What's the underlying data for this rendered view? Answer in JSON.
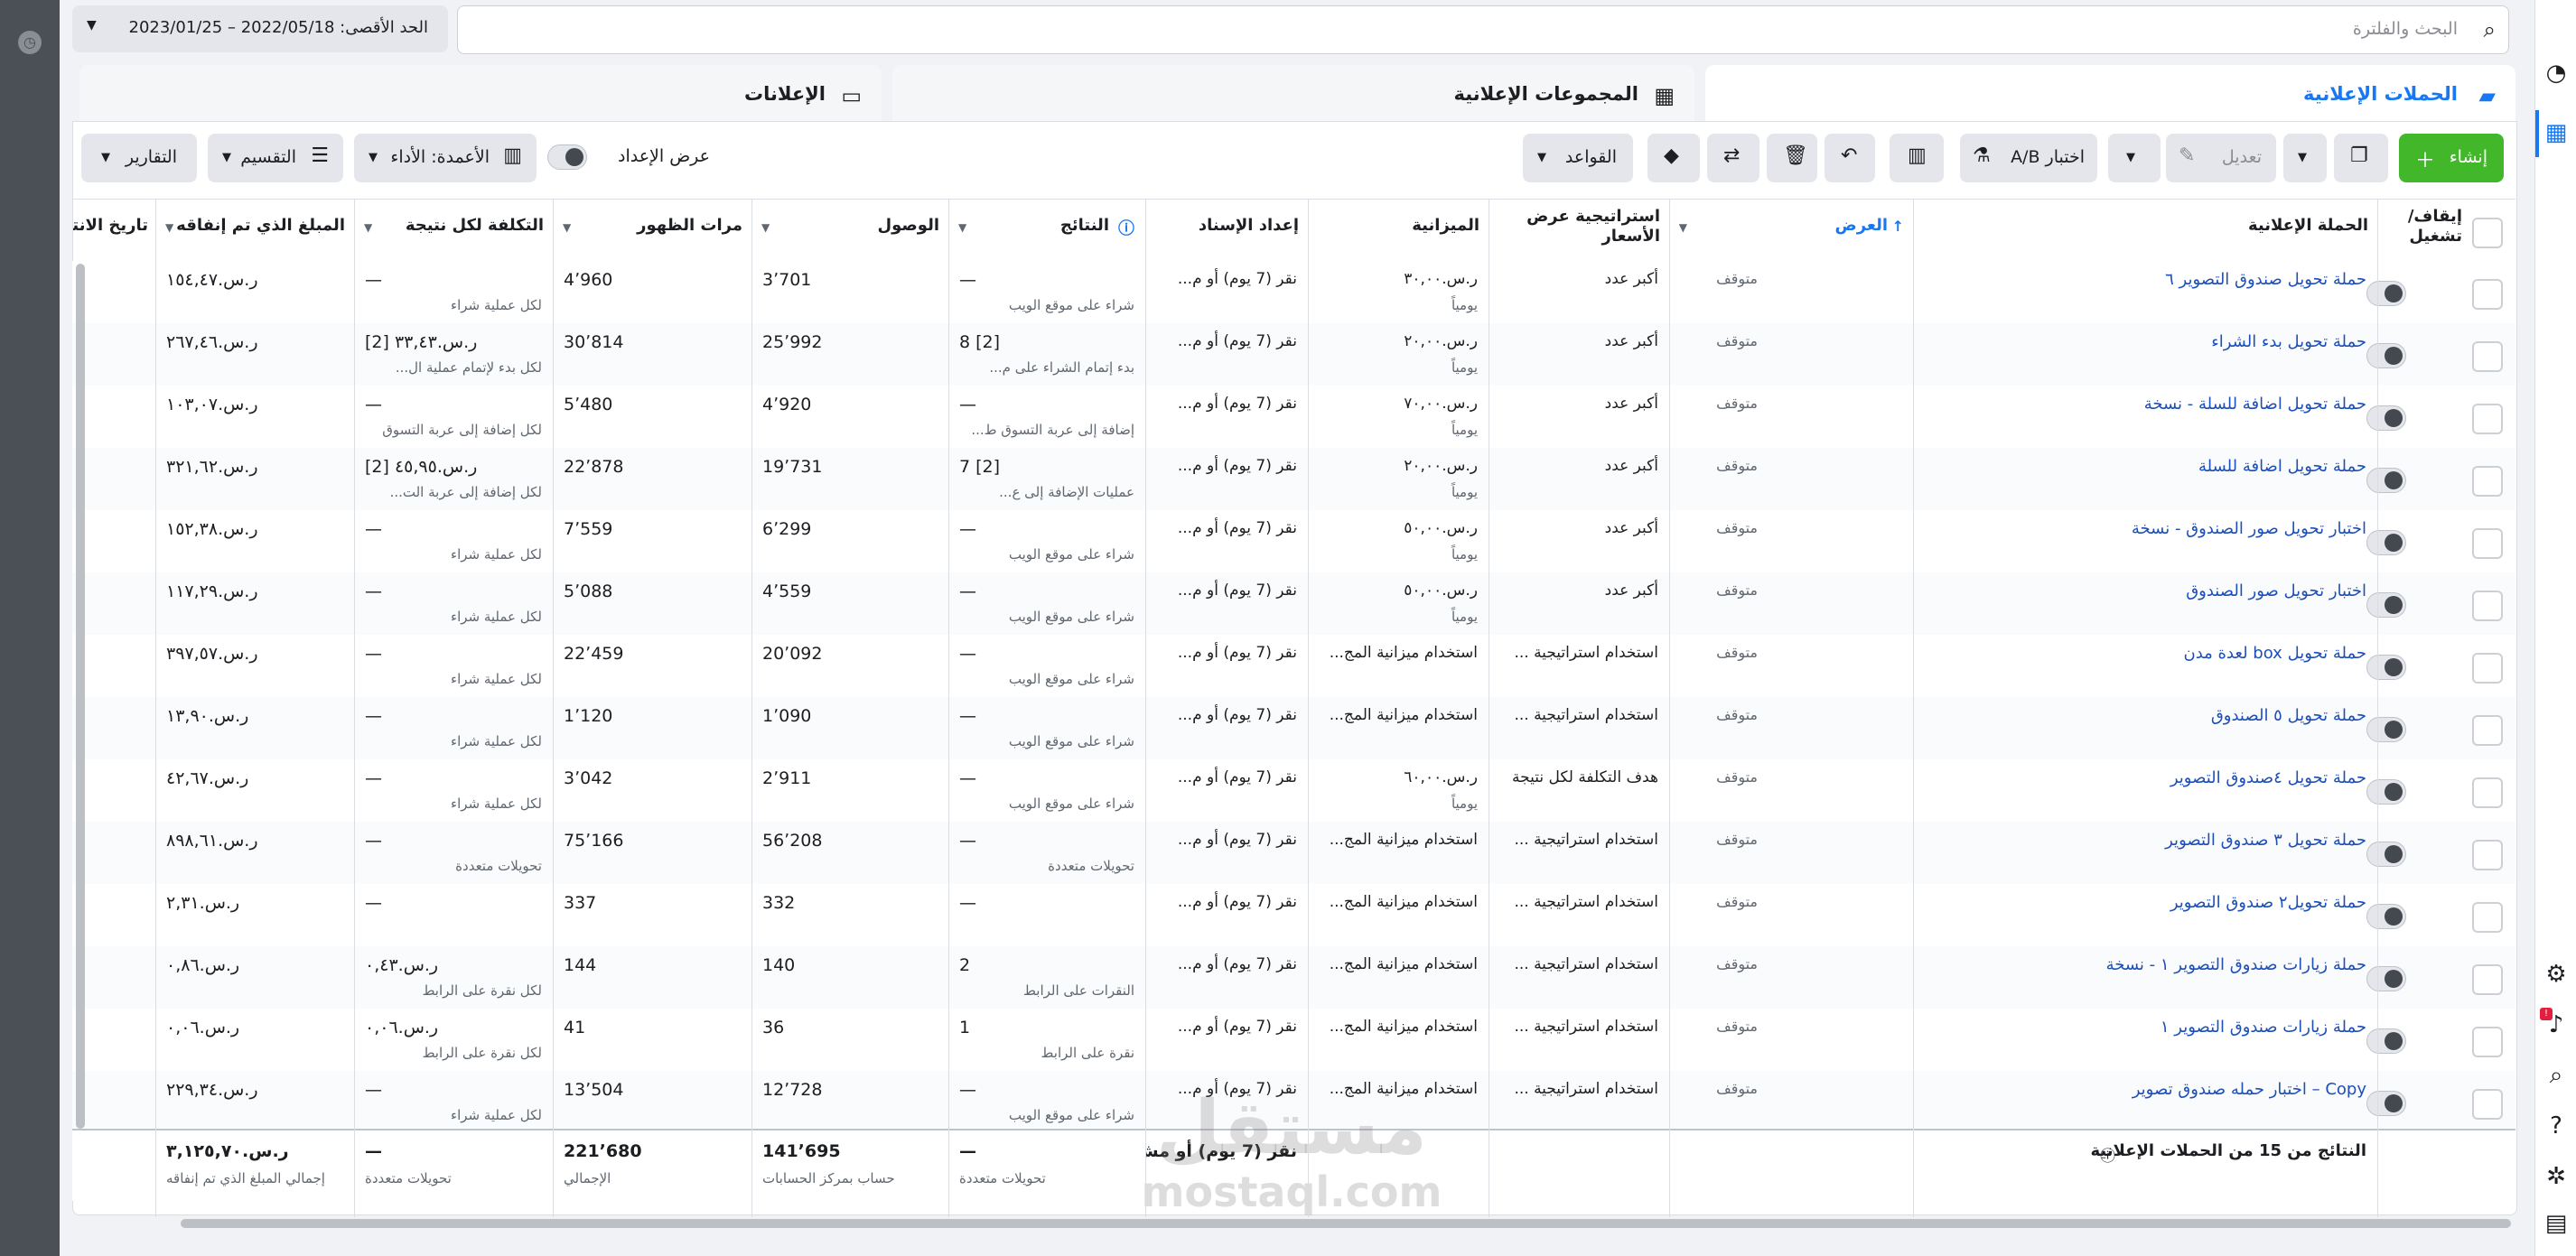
{
  "search": {
    "placeholder": "البحث والفلترة"
  },
  "date_range": {
    "label": "الحد الأقصى: 2022/05/18 – 2023/01/25"
  },
  "tabs": [
    {
      "label": "الحملات الإعلانية",
      "icon": "folder-icon"
    },
    {
      "label": "المجموعات الإعلانية",
      "icon": "grid-icon"
    },
    {
      "label": "الإعلانات",
      "icon": "ad-icon"
    }
  ],
  "toolbar": {
    "create": "إنشاء",
    "edit": "تعديل",
    "ab_test": "اختبار A/B",
    "rules": "القواعد",
    "setup_toggle": "عرض الإعداد",
    "columns": "الأعمدة: الأداء",
    "breakdown": "التقسيم",
    "reports": "التقارير"
  },
  "headers": {
    "toggle": "إيقاف/ تشغيل",
    "campaign": "الحملة الإعلانية",
    "delivery": "العرض",
    "bid_strategy": "استراتيجية عرض الأسعار",
    "budget": "الميزانية",
    "attribution": "إعداد الإسناد",
    "results": "النتائج",
    "reach": "الوصول",
    "impressions": "مرات الظهور",
    "cost_per_result": "التكلفة لكل نتيجة",
    "amount_spent": "المبلغ الذي تم إنفاقه",
    "end": "تاريخ الانته"
  },
  "rows": [
    {
      "name": "حملة تحويل صندوق التصوير ٦",
      "delivery": "متوقف",
      "bid": "أكبر عدد",
      "budget": "ر.س.٣٠,٠٠",
      "budget_sub": "يومياً",
      "attr": "نقر (7 يوم) أو م...",
      "results": "—",
      "results_sub": "شراء على موقع الويب",
      "reach": "3٬701",
      "impr": "4٬960",
      "cost": "—",
      "cost_sub": "لكل عملية شراء",
      "spent": "ر.س.١٥٤,٤٧"
    },
    {
      "name": "حملة تحويل بدء الشراء",
      "delivery": "متوقف",
      "bid": "أكبر عدد",
      "budget": "ر.س.٢٠,٠٠",
      "budget_sub": "يومياً",
      "attr": "نقر (7 يوم) أو م...",
      "results": "8 [2]",
      "results_sub": "بدء إتمام الشراء على م...",
      "reach": "25٬992",
      "impr": "30٬814",
      "cost": "ر.س.٣٣,٤٣ [2]",
      "cost_sub": "لكل بدء لإتمام عملية ال...",
      "spent": "ر.س.٢٦٧,٤٦"
    },
    {
      "name": "حملة تحويل اضافة للسلة - نسخة",
      "delivery": "متوقف",
      "bid": "أكبر عدد",
      "budget": "ر.س.٧٠,٠٠",
      "budget_sub": "يومياً",
      "attr": "نقر (7 يوم) أو م...",
      "results": "—",
      "results_sub": "إضافة إلى عربة التسوق ط...",
      "reach": "4٬920",
      "impr": "5٬480",
      "cost": "—",
      "cost_sub": "لكل إضافة إلى عربة التسوق",
      "spent": "ر.س.١٠٣,٠٧"
    },
    {
      "name": "حملة تحويل اضافة للسلة",
      "delivery": "متوقف",
      "bid": "أكبر عدد",
      "budget": "ر.س.٢٠,٠٠",
      "budget_sub": "يومياً",
      "attr": "نقر (7 يوم) أو م...",
      "results": "7 [2]",
      "results_sub": "عمليات الإضافة إلى ع...",
      "reach": "19٬731",
      "impr": "22٬878",
      "cost": "ر.س.٤٥,٩٥ [2]",
      "cost_sub": "لكل إضافة إلى عربة الت...",
      "spent": "ر.س.٣٢١,٦٢"
    },
    {
      "name": "اختبار تحويل صور الصندوق - نسخة",
      "delivery": "متوقف",
      "bid": "أكبر عدد",
      "budget": "ر.س.٥٠,٠٠",
      "budget_sub": "يومياً",
      "attr": "نقر (7 يوم) أو م...",
      "results": "—",
      "results_sub": "شراء على موقع الويب",
      "reach": "6٬299",
      "impr": "7٬559",
      "cost": "—",
      "cost_sub": "لكل عملية شراء",
      "spent": "ر.س.١٥٢,٣٨"
    },
    {
      "name": "اختبار تحويل صور الصندوق",
      "delivery": "متوقف",
      "bid": "أكبر عدد",
      "budget": "ر.س.٥٠,٠٠",
      "budget_sub": "يومياً",
      "attr": "نقر (7 يوم) أو م...",
      "results": "—",
      "results_sub": "شراء على موقع الويب",
      "reach": "4٬559",
      "impr": "5٬088",
      "cost": "—",
      "cost_sub": "لكل عملية شراء",
      "spent": "ر.س.١١٧,٢٩"
    },
    {
      "name": "حملة تحويل box لعدة مدن",
      "delivery": "متوقف",
      "bid": "استخدام استراتيجية ...",
      "budget": "استخدام ميزانية المج...",
      "budget_sub": "",
      "attr": "نقر (7 يوم) أو م...",
      "results": "—",
      "results_sub": "شراء على موقع الويب",
      "reach": "20٬092",
      "impr": "22٬459",
      "cost": "—",
      "cost_sub": "لكل عملية شراء",
      "spent": "ر.س.٣٩٧,٥٧"
    },
    {
      "name": "حملة تحويل ٥ الصندوق",
      "delivery": "متوقف",
      "bid": "استخدام استراتيجية ...",
      "budget": "استخدام ميزانية المج...",
      "budget_sub": "",
      "attr": "نقر (7 يوم) أو م...",
      "results": "—",
      "results_sub": "شراء على موقع الويب",
      "reach": "1٬090",
      "impr": "1٬120",
      "cost": "—",
      "cost_sub": "لكل عملية شراء",
      "spent": "ر.س.١٣,٩٠"
    },
    {
      "name": "حملة تحويل ٤صندوق التصوير",
      "delivery": "متوقف",
      "bid": "هدف التكلفة لكل نتيجة",
      "budget": "ر.س.٦٠,٠٠",
      "budget_sub": "يومياً",
      "attr": "نقر (7 يوم) أو م...",
      "results": "—",
      "results_sub": "شراء على موقع الويب",
      "reach": "2٬911",
      "impr": "3٬042",
      "cost": "—",
      "cost_sub": "لكل عملية شراء",
      "spent": "ر.س.٤٢,٦٧"
    },
    {
      "name": "حملة تحويل ٣ صندوق التصوير",
      "delivery": "متوقف",
      "bid": "استخدام استراتيجية ...",
      "budget": "استخدام ميزانية المج...",
      "budget_sub": "",
      "attr": "نقر (7 يوم) أو م...",
      "results": "—",
      "results_sub": "تحويلات متعددة",
      "reach": "56٬208",
      "impr": "75٬166",
      "cost": "—",
      "cost_sub": "تحويلات متعددة",
      "spent": "ر.س.٨٩٨,٦١"
    },
    {
      "name": "حملة تحويل٢ صندوق التصوير",
      "delivery": "متوقف",
      "bid": "استخدام استراتيجية ...",
      "budget": "استخدام ميزانية المج...",
      "budget_sub": "",
      "attr": "نقر (7 يوم) أو م...",
      "results": "—",
      "results_sub": "",
      "reach": "332",
      "impr": "337",
      "cost": "—",
      "cost_sub": "",
      "spent": "ر.س.٢,٣١"
    },
    {
      "name": "حملة زيارات صندوق التصوير ١ - نسخة",
      "delivery": "متوقف",
      "bid": "استخدام استراتيجية ...",
      "budget": "استخدام ميزانية المج...",
      "budget_sub": "",
      "attr": "نقر (7 يوم) أو م...",
      "results": "2",
      "results_sub": "النقرات على الرابط",
      "reach": "140",
      "impr": "144",
      "cost": "ر.س.٠,٤٣",
      "cost_sub": "لكل نقرة على الرابط",
      "spent": "ر.س.٠,٨٦"
    },
    {
      "name": "حملة زيارات صندوق التصوير ١",
      "delivery": "متوقف",
      "bid": "استخدام استراتيجية ...",
      "budget": "استخدام ميزانية المج...",
      "budget_sub": "",
      "attr": "نقر (7 يوم) أو م...",
      "results": "1",
      "results_sub": "نقرة على الرابط",
      "reach": "36",
      "impr": "41",
      "cost": "ر.س.٠,٠٦",
      "cost_sub": "لكل نقرة على الرابط",
      "spent": "ر.س.٠,٠٦"
    },
    {
      "name": "Copy – اختبار حمله صندوق تصوير",
      "delivery": "متوقف",
      "bid": "استخدام استراتيجية ...",
      "budget": "استخدام ميزانية المج...",
      "budget_sub": "",
      "attr": "نقر (7 يوم) أو م...",
      "results": "—",
      "results_sub": "شراء على موقع الويب",
      "reach": "12٬728",
      "impr": "13٬504",
      "cost": "—",
      "cost_sub": "لكل عملية شراء",
      "spent": "ر.س.٢٢٩,٣٤"
    }
  ],
  "footer": {
    "label": "النتائج من 15 من الحملات الإعلانية",
    "attr": "نقر (7 يوم) أو مش...",
    "results": "—",
    "results_sub": "تحويلات متعددة",
    "reach": "141٬695",
    "reach_sub": "حساب بمركز الحسابات",
    "impr": "221٬680",
    "impr_sub": "الإجمالي",
    "cost": "—",
    "cost_sub": "تحويلات متعددة",
    "spent": "ر.س.٣,١٢٥,٧٠",
    "spent_sub": "إجمالي المبلغ الذي تم إنفاقه"
  },
  "watermark": {
    "ar": "مستقل",
    "en": "mostaql.com"
  }
}
